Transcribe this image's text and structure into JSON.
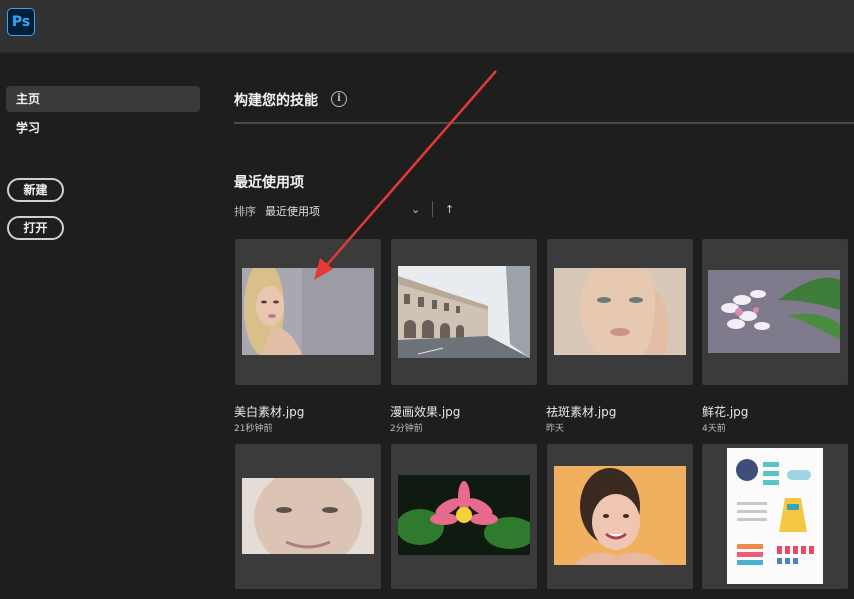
{
  "app": {
    "logo_text": "Ps"
  },
  "sidebar": {
    "items": [
      {
        "label": "主页",
        "active": true
      },
      {
        "label": "学习",
        "active": false
      }
    ],
    "new_button": "新建",
    "open_button": "打开"
  },
  "main": {
    "skills_title": "构建您的技能",
    "info_glyph": "i",
    "recent_title": "最近使用项",
    "sort": {
      "label": "排序",
      "value": "最近使用项",
      "chevron": "⌄",
      "direction_glyph": "↑"
    },
    "files": [
      {
        "name": "美白素材.jpg",
        "time": "21秒钟前"
      },
      {
        "name": "漫画效果.jpg",
        "time": "2分钟前"
      },
      {
        "name": "祛斑素材.jpg",
        "time": "昨天"
      },
      {
        "name": "鲜花.jpg",
        "time": "4天前"
      }
    ]
  },
  "colors": {
    "accent": "#31a8ff",
    "annotation_arrow": "#e53935",
    "background": "#1e1e1e",
    "card": "#3b3b3b"
  }
}
